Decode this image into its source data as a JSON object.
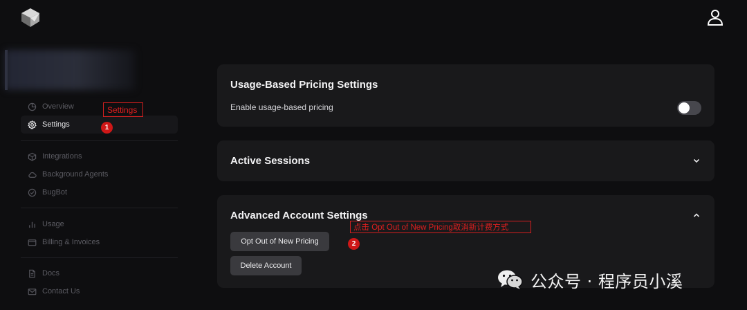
{
  "header": {
    "logo_icon": "cube-logo-icon",
    "account_icon": "user-icon"
  },
  "sidebar": {
    "items": [
      {
        "label": "Overview",
        "icon": "pie-chart-icon",
        "active": false
      },
      {
        "label": "Settings",
        "icon": "gear-icon",
        "active": true
      },
      {
        "label": "Integrations",
        "icon": "box-icon",
        "active": false
      },
      {
        "label": "Background Agents",
        "icon": "cloud-icon",
        "active": false
      },
      {
        "label": "BugBot",
        "icon": "check-circle-icon",
        "active": false
      },
      {
        "label": "Usage",
        "icon": "bar-chart-icon",
        "active": false
      },
      {
        "label": "Billing & Invoices",
        "icon": "credit-card-icon",
        "active": false
      },
      {
        "label": "Docs",
        "icon": "document-icon",
        "active": false
      },
      {
        "label": "Contact Us",
        "icon": "mail-icon",
        "active": false
      }
    ]
  },
  "main": {
    "usage_card": {
      "title": "Usage-Based Pricing Settings",
      "toggle_label": "Enable usage-based pricing",
      "toggle_on": false
    },
    "sessions_card": {
      "title": "Active Sessions"
    },
    "advanced_card": {
      "title": "Advanced Account Settings",
      "opt_out_button": "Opt Out of New Pricing",
      "delete_button": "Delete Account"
    }
  },
  "annotations": {
    "settings_label": "Settings",
    "step1": "1",
    "optout_label": "点击 Opt Out of New Pricing取消新计费方式",
    "step2": "2",
    "color": "#e01f1f"
  },
  "watermark": {
    "text": "公众号 · 程序员小溪",
    "icon": "wechat-icon"
  }
}
